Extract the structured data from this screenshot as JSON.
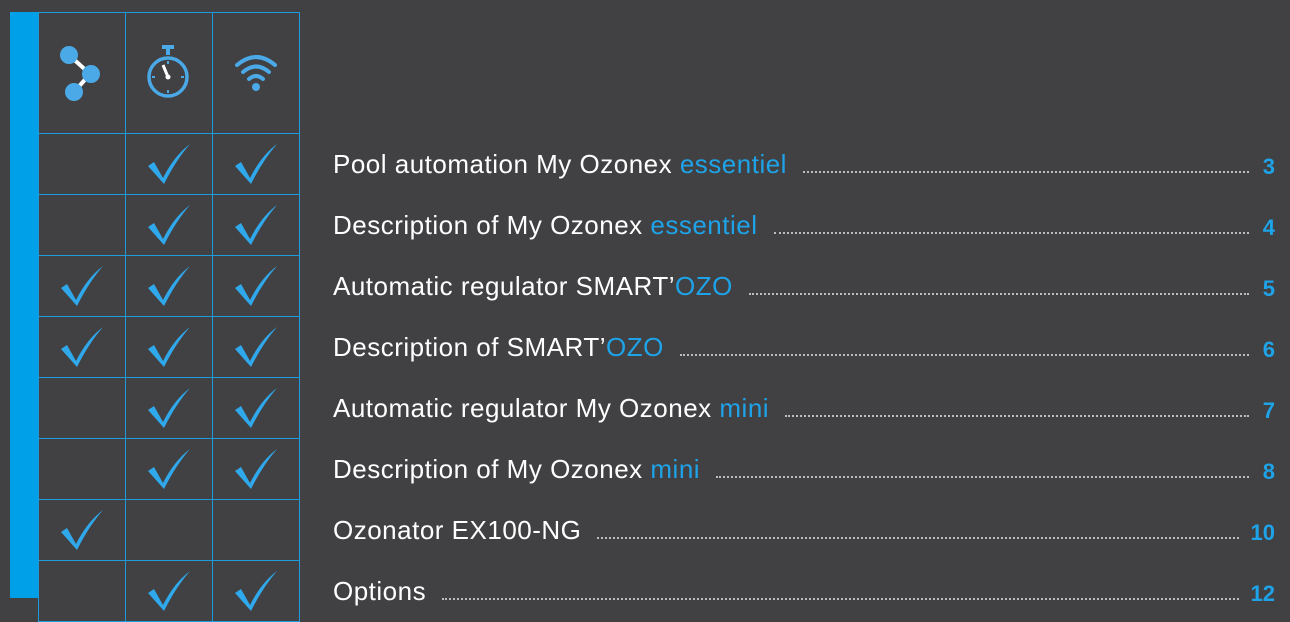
{
  "header_icons": [
    "network-icon",
    "stopwatch-icon",
    "wifi-icon"
  ],
  "colors": {
    "background": "#414042",
    "accent": "#1ea3e8",
    "grid": "#1e9bdc",
    "bar": "#00a0e9"
  },
  "rows": [
    {
      "title": "Pool automation My Ozonex ",
      "highlight": "essentiel",
      "page": "3",
      "checks": [
        false,
        true,
        true
      ]
    },
    {
      "title": "Description of My Ozonex ",
      "highlight": "essentiel",
      "page": "4",
      "checks": [
        false,
        true,
        true
      ]
    },
    {
      "title": "Automatic regulator SMART’",
      "highlight": "OZO",
      "page": "5",
      "checks": [
        true,
        true,
        true
      ]
    },
    {
      "title": "Description of SMART’",
      "highlight": "OZO",
      "page": "6",
      "checks": [
        true,
        true,
        true
      ]
    },
    {
      "title": "Automatic regulator My Ozonex ",
      "highlight": "mini",
      "page": "7",
      "checks": [
        false,
        true,
        true
      ]
    },
    {
      "title": "Description of My Ozonex ",
      "highlight": "mini",
      "page": "8",
      "checks": [
        false,
        true,
        true
      ]
    },
    {
      "title": "Ozonator EX100-NG",
      "highlight": "",
      "page": "10",
      "checks": [
        true,
        false,
        false
      ]
    },
    {
      "title": "Options",
      "highlight": "",
      "page": "12",
      "checks": [
        false,
        true,
        true
      ]
    }
  ]
}
